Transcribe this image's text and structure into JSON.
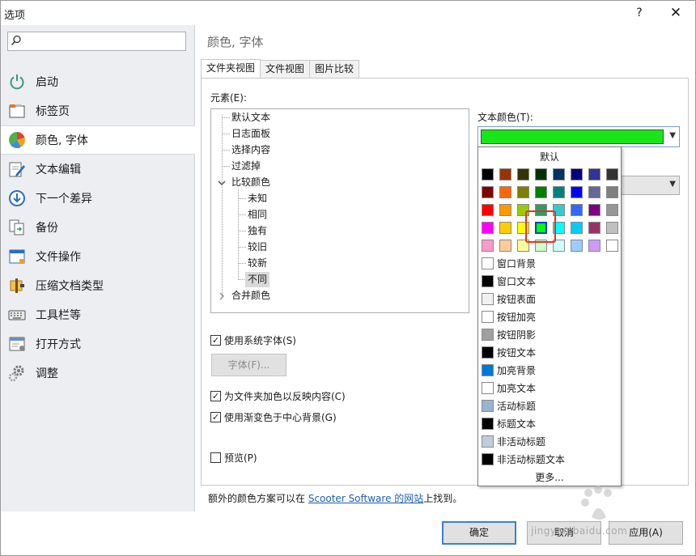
{
  "window": {
    "title": "选项",
    "help": "?",
    "close": "✕"
  },
  "sidebar": {
    "search_placeholder": "",
    "items": [
      {
        "label": "启动",
        "icon": "power-icon"
      },
      {
        "label": "标签页",
        "icon": "tabs-icon"
      },
      {
        "label": "颜色, 字体",
        "icon": "palette-icon",
        "selected": true
      },
      {
        "label": "文本编辑",
        "icon": "edit-icon"
      },
      {
        "label": "下一个差异",
        "icon": "next-diff-icon"
      },
      {
        "label": "备份",
        "icon": "backup-icon"
      },
      {
        "label": "文件操作",
        "icon": "file-ops-icon"
      },
      {
        "label": "压缩文档类型",
        "icon": "archive-icon"
      },
      {
        "label": "工具栏等",
        "icon": "keyboard-icon"
      },
      {
        "label": "打开方式",
        "icon": "open-with-icon"
      },
      {
        "label": "调整",
        "icon": "tweak-icon"
      }
    ]
  },
  "main": {
    "heading": "颜色, 字体",
    "tabs": [
      "文件夹视图",
      "文件视图",
      "图片比较"
    ],
    "elements_label": "元素(E):",
    "tree": {
      "items": [
        "默认文本",
        "日志面板",
        "选择内容",
        "过滤掉",
        "比较颜色"
      ],
      "children": [
        "未知",
        "相同",
        "独有",
        "较旧",
        "较新",
        "不同"
      ],
      "last": "合并颜色"
    },
    "text_color_label": "文本颜色(T):",
    "use_system_font": "使用系统字体(S)",
    "font_button": "字体(F)...",
    "colorize_folders": "为文件夹加色以反映内容(C)",
    "gradient_background": "使用渐变色于中心背景(G)",
    "preview": "预览(P)",
    "footer_prefix": "额外的颜色方案可以在 ",
    "footer_link": "Scooter Software 的网站",
    "footer_suffix": "上找到。"
  },
  "color_picker": {
    "default_label": "默认",
    "palette": [
      [
        "#000000",
        "#993300",
        "#333300",
        "#003300",
        "#003366",
        "#000080",
        "#333399",
        "#333333"
      ],
      [
        "#800000",
        "#ff6600",
        "#808000",
        "#008000",
        "#008080",
        "#0000ff",
        "#666699",
        "#808080"
      ],
      [
        "#ff0000",
        "#ff9900",
        "#99cc00",
        "#339966",
        "#33cccc",
        "#3366ff",
        "#800080",
        "#969696"
      ],
      [
        "#ff00ff",
        "#ffcc00",
        "#ffff00",
        "#00ff00",
        "#00ffff",
        "#00ccff",
        "#993366",
        "#c0c0c0"
      ],
      [
        "#ff99cc",
        "#ffcc99",
        "#ffff99",
        "#ccffcc",
        "#ccffff",
        "#99ccff",
        "#cc99ff",
        "#ffffff"
      ]
    ],
    "system_colors": [
      {
        "label": "窗口背景",
        "color": "#ffffff"
      },
      {
        "label": "窗口文本",
        "color": "#000000"
      },
      {
        "label": "按钮表面",
        "color": "#f0f0f0"
      },
      {
        "label": "按钮加亮",
        "color": "#ffffff"
      },
      {
        "label": "按钮阴影",
        "color": "#a0a0a0"
      },
      {
        "label": "按钮文本",
        "color": "#000000"
      },
      {
        "label": "加亮背景",
        "color": "#0078d7"
      },
      {
        "label": "加亮文本",
        "color": "#ffffff"
      },
      {
        "label": "活动标题",
        "color": "#99b4d1"
      },
      {
        "label": "标题文本",
        "color": "#000000"
      },
      {
        "label": "非活动标题",
        "color": "#bfcddb"
      },
      {
        "label": "非活动标题文本",
        "color": "#000000"
      }
    ],
    "more_label": "更多...",
    "selected_color": "#19e619"
  },
  "buttons": {
    "ok": "确定",
    "cancel": "取消",
    "apply": "应用(A)"
  },
  "watermark": {
    "logo": "Baidu经验",
    "url": "jingyan.baidu.com"
  }
}
